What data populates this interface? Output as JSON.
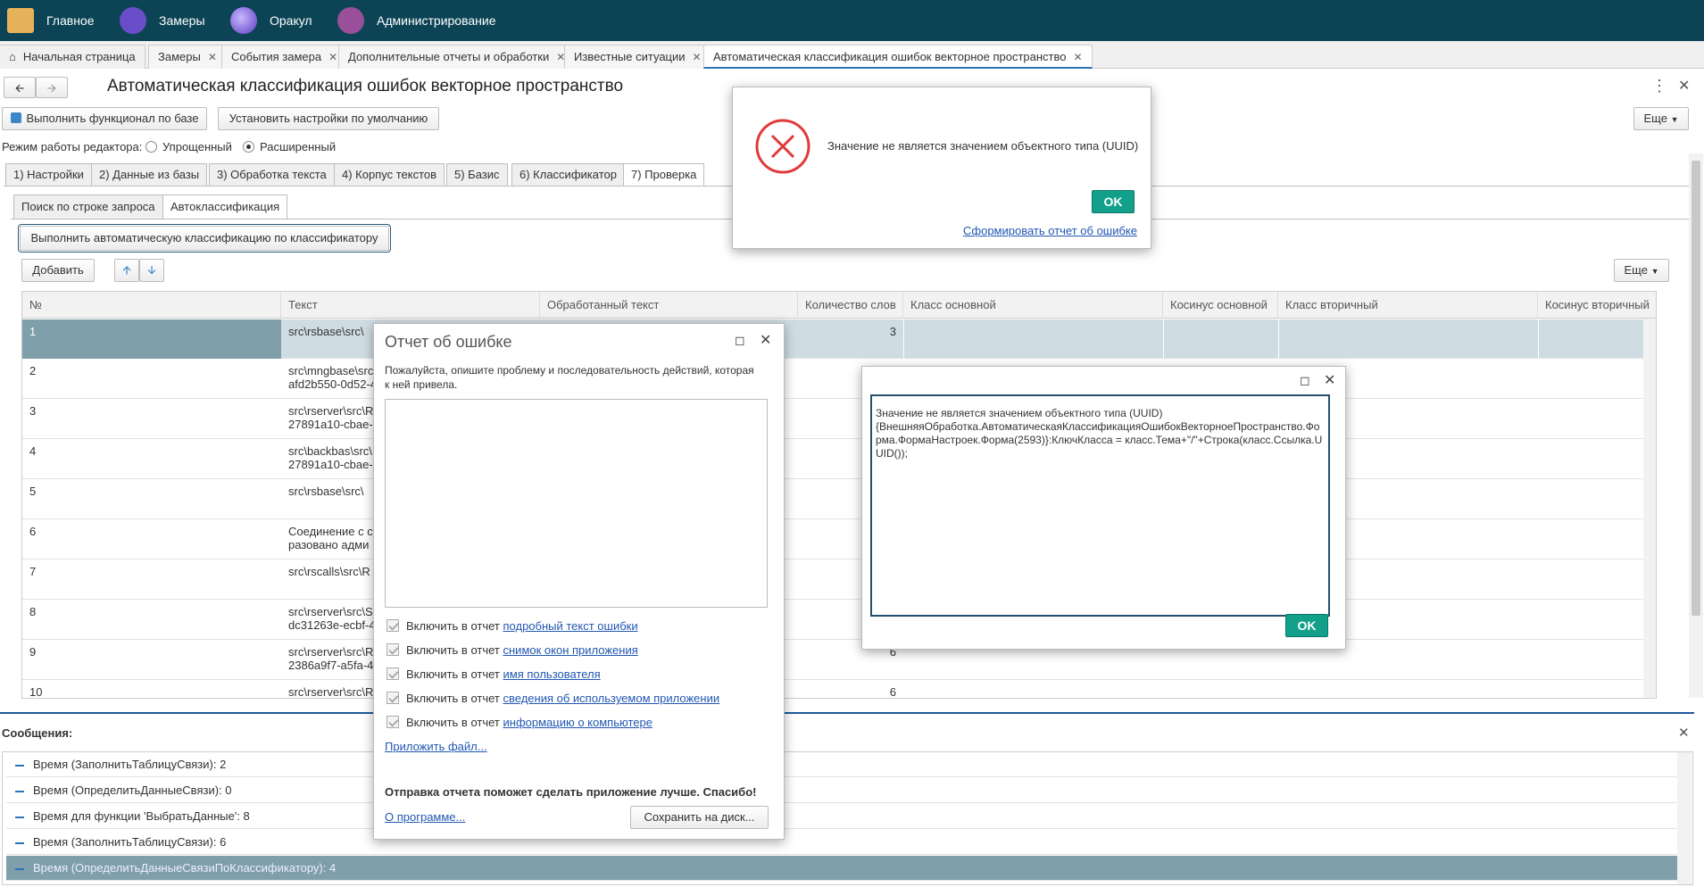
{
  "topbar": {
    "items": [
      {
        "label": "Главное",
        "icon": "home-building-icon",
        "color": "#e7b35a"
      },
      {
        "label": "Замеры",
        "icon": "flask-icon",
        "color": "#6a4dc8"
      },
      {
        "label": "Оракул",
        "icon": "crystal-ball-icon",
        "color": "#7a5bd0"
      },
      {
        "label": "Администрирование",
        "icon": "admin-potion-icon",
        "color": "#9a4f9a"
      }
    ]
  },
  "tabs": [
    {
      "label": "Начальная страница",
      "closable": false
    },
    {
      "label": "Замеры",
      "closable": true
    },
    {
      "label": "События замера",
      "closable": true
    },
    {
      "label": "Дополнительные отчеты и обработки",
      "closable": true
    },
    {
      "label": "Известные ситуации",
      "closable": true
    },
    {
      "label": "Автоматическая классификация ошибок векторное пространство",
      "closable": true,
      "active": true
    }
  ],
  "form": {
    "title": "Автоматическая классификация ошибок векторное пространство",
    "run_button": "Выполнить функционал по базе",
    "defaults_button": "Установить настройки по умолчанию",
    "more_label": "Еще",
    "mode_label": "Режим работы редактора:",
    "mode_simple": "Упрощенный",
    "mode_extended": "Расширенный",
    "page_tabs": [
      "1) Настройки",
      "2) Данные из базы",
      "3) Обработка текста",
      "4) Корпус текстов",
      "5) Базис",
      "6) Классификатор",
      "7) Проверка"
    ],
    "sub_tabs": [
      "Поиск по строке запроса",
      "Автоклассификация"
    ],
    "auto_button": "Выполнить автоматическую классификацию по классификатору",
    "add_button": "Добавить",
    "grid_more_label": "Еще"
  },
  "grid": {
    "columns": [
      "№",
      "Текст",
      "Обработанный текст",
      "Количество слов",
      "Класс основной",
      "Косинус основной",
      "Класс вторичный",
      "Косинус вторичный"
    ],
    "rows": [
      {
        "n": "1",
        "text1": "src\\rsbase\\src\\",
        "text2": "",
        "count": "3"
      },
      {
        "n": "2",
        "text1": "src\\mngbase\\src",
        "text2": "afd2b550-0d52-4",
        "count": ""
      },
      {
        "n": "3",
        "text1": "src\\rserver\\src\\R",
        "text2": "27891a10-cbae-4",
        "count": ""
      },
      {
        "n": "4",
        "text1": "src\\backbas\\src\\",
        "text2": "27891a10-cbae-4",
        "count": ""
      },
      {
        "n": "5",
        "text1": "src\\rsbase\\src\\",
        "text2": "",
        "count": ""
      },
      {
        "n": "6",
        "text1": "Соединение с с",
        "text2": "разовано адми",
        "count": ""
      },
      {
        "n": "7",
        "text1": "src\\rscalls\\src\\R",
        "text2": "",
        "count": ""
      },
      {
        "n": "8",
        "text1": "src\\rserver\\src\\S",
        "text2": "dc31263e-ecbf-4",
        "count": ""
      },
      {
        "n": "9",
        "text1": "src\\rserver\\src\\R",
        "text2": "2386a9f7-a5fa-4c",
        "count": "6"
      },
      {
        "n": "10",
        "text1": "src\\rserver\\src\\R",
        "text2": "",
        "count": "6"
      }
    ]
  },
  "messages": {
    "title": "Сообщения:",
    "items": [
      "Время (ЗаполнитьТаблицуСвязи): 2",
      "Время (ОпределитьДанныеСвязи): 0",
      "Время для функции 'ВыбратьДанные': 8",
      "Время (ЗаполнитьТаблицуСвязи): 6",
      "Время (ОпределитьДанныеСвязиПоКлассификатору): 4"
    ]
  },
  "error_dialog": {
    "message": "Значение не является значением объектного типа (UUID)",
    "ok": "OK",
    "report_link": "Сформировать отчет об ошибке"
  },
  "report_dialog": {
    "title": "Отчет об ошибке",
    "prompt": "Пожалуйста, опишите проблему и последовательность действий, которая к ней привела.",
    "include_prefix": "Включить в отчет",
    "options": [
      "подробный текст ошибки",
      "снимок окон приложения",
      "имя пользователя",
      "сведения об используемом приложении",
      "информацию о компьютере"
    ],
    "attach": "Приложить файл...",
    "thanks": "Отправка отчета поможет сделать приложение лучше. Спасибо!",
    "about": "О программе...",
    "save": "Сохранить на диск..."
  },
  "detail_dialog": {
    "text": "Значение не является значением объектного типа (UUID)\n{ВнешняяОбработка.АвтоматическаяКлассификацияОшибокВекторноеПространство.Форма.ФормаНастроек.Форма(2593)}:КлючКласса = класс.Тема+\"/\"+Строка(класс.Ссылка.UUID());",
    "ok": "OK"
  }
}
